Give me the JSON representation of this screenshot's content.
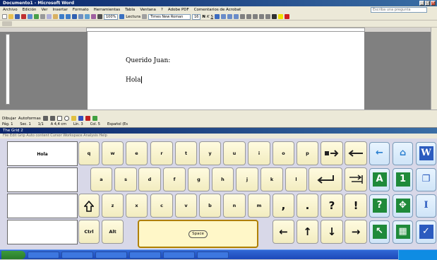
{
  "window": {
    "title": "Documento1 - Microsoft Word"
  },
  "menu": {
    "items": [
      "Archivo",
      "Edición",
      "Ver",
      "Insertar",
      "Formato",
      "Herramientas",
      "Tabla",
      "Ventana",
      "?",
      "Adobe PDF",
      "Comentarios de Acrobat"
    ],
    "help_placeholder": "Escriba una pregunta"
  },
  "toolbar": {
    "zoom": "100%",
    "read_label": "Lectura",
    "font_name": "Times New Roman",
    "font_size": "16"
  },
  "document": {
    "line1": "Querido Juan:",
    "line2": "Hola"
  },
  "drawing": {
    "draw_label": "Dibujar",
    "autoshapes_label": "Autoformas"
  },
  "status": {
    "page": "Pág. 1",
    "section": "Sec. 1",
    "page_of": "1/1",
    "at": "A 4,4 cm",
    "line": "Lín. 3",
    "col": "Col. 5",
    "lang": "Español (Es"
  },
  "keyboard": {
    "title": "The Grid 2",
    "menu": "File  Edit  Grip  Auto content  Cursor  Workspace  Analysis  Help",
    "prediction": "Hola",
    "row1": [
      "q",
      "w",
      "e",
      "r",
      "t",
      "y",
      "u",
      "i",
      "o",
      "p",
      "",
      ""
    ],
    "row2": [
      "a",
      "s",
      "d",
      "f",
      "g",
      "h",
      "j",
      "k",
      "l",
      "",
      ""
    ],
    "row3": [
      "",
      "z",
      "x",
      "c",
      "v",
      "b",
      "n",
      "m",
      ",",
      ".",
      "?",
      "!"
    ],
    "row4": [
      "Ctrl",
      "Alt",
      "Space",
      "←",
      "↑",
      "↓",
      "→"
    ],
    "arrow_back": "←",
    "home": "⌂",
    "word": "W",
    "letters": "A",
    "numbers": "1",
    "windows": "❐",
    "question": "?",
    "move": "✥",
    "text": "I",
    "pointer": "↖",
    "grid": "▦",
    "check": "✓"
  },
  "colors": {
    "accent": "#0a246a",
    "key": "#f7f1cc",
    "side_key": "#d9eaf8"
  }
}
